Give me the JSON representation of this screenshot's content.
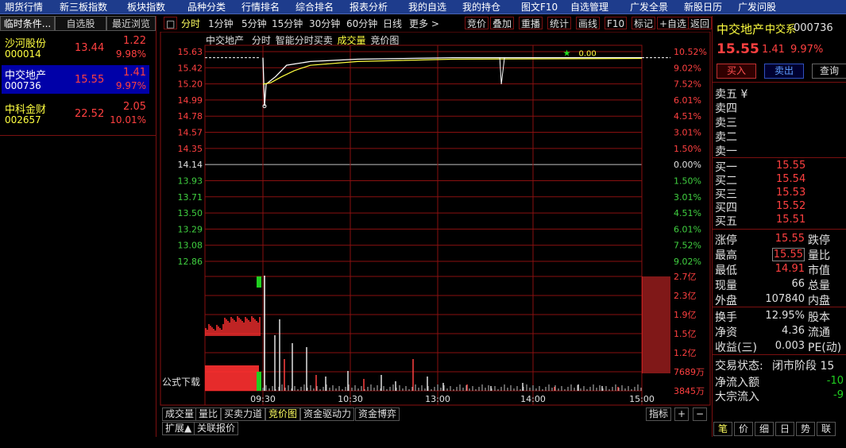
{
  "menu": [
    "期货行情",
    "新三板指数",
    "板块指数",
    "品种分类",
    "行情排名",
    "综合排名",
    "报表分析",
    "我的自选",
    "我的持仓",
    "图文F10",
    "自选管理",
    "广发全景",
    "新股日历",
    "广发问股"
  ],
  "left_tabs": [
    "临时条件...",
    "自选股",
    "最近浏览"
  ],
  "stocks": [
    {
      "name": "沙河股份",
      "code": "000014",
      "price": "13.44",
      "change": "1.22",
      "pct": "9.98%"
    },
    {
      "name": "中交地产",
      "code": "000736",
      "price": "15.55",
      "change": "1.41",
      "pct": "9.97%"
    },
    {
      "name": "中科金财",
      "code": "002657",
      "price": "22.52",
      "change": "2.05",
      "pct": "10.01%"
    }
  ],
  "toolbar": {
    "collapse": "□",
    "periods": [
      "分时",
      "1分钟",
      "5分钟",
      "15分钟",
      "30分钟",
      "60分钟",
      "日线",
      "更多 >"
    ],
    "tools": [
      "竞价",
      "叠加",
      "重播",
      "统计",
      "画线",
      "F10",
      "标记",
      "+自选",
      "返回"
    ]
  },
  "chart_info": {
    "name": "中交地产",
    "mode": "分时",
    "extra": "智能分时买卖",
    "vol": "成交量",
    "auction": "竞价图"
  },
  "formula_download": "公式下载",
  "bottom_tabs": [
    "成交量",
    "量比",
    "买卖力道",
    "竞价图",
    "资金驱动力",
    "资金博弈"
  ],
  "indicator_tab": "指标",
  "plus": "+",
  "minus": "−",
  "bottom_bar": [
    "扩展▲",
    "关联报价"
  ],
  "right": {
    "title": "中交地产",
    "subtitle": "中交系",
    "code": "000736",
    "price": "15.55",
    "change": "1.41",
    "pct": "9.97%",
    "buy": "买入",
    "sell": "卖出",
    "query": "查询",
    "ask_labels": [
      "卖五 ¥",
      "卖四",
      "卖三",
      "卖二",
      "卖一"
    ],
    "bid_labels": [
      "买一",
      "买二",
      "买三",
      "买四",
      "买五"
    ],
    "bid_prices": [
      "15.55",
      "15.54",
      "15.53",
      "15.52",
      "15.51"
    ],
    "stats": [
      {
        "l": "涨停",
        "v": "15.55",
        "r": "跌停"
      },
      {
        "l": "最高",
        "v": "15.55",
        "r": "量比"
      },
      {
        "l": "最低",
        "v": "14.91",
        "r": "市值"
      },
      {
        "l": "现量",
        "v": "66",
        "r": "总量"
      },
      {
        "l": "外盘",
        "v": "107840",
        "r": "内盘"
      }
    ],
    "stats2": [
      {
        "l": "换手",
        "v": "12.95%",
        "r": "股本"
      },
      {
        "l": "净资",
        "v": "4.36",
        "r": "流通"
      },
      {
        "l": "收益(三)",
        "v": "0.003",
        "r": "PE(动)"
      }
    ],
    "state_label": "交易状态:",
    "state_value": "闭市阶段 15",
    "flow": [
      {
        "l": "净流入额",
        "v": "-10"
      },
      {
        "l": "大宗流入",
        "v": "-9"
      }
    ],
    "tabs": [
      "笔",
      "价",
      "细",
      "日",
      "势",
      "联"
    ]
  },
  "chart_data": {
    "type": "line",
    "title": "中交地产 分时",
    "y_left_ticks": [
      "15.63",
      "15.42",
      "15.20",
      "14.99",
      "14.78",
      "14.57",
      "14.35",
      "14.14",
      "13.93",
      "13.71",
      "13.50",
      "13.29",
      "13.08",
      "12.86"
    ],
    "y_right_ticks": [
      "10.52%",
      "9.02%",
      "7.52%",
      "6.01%",
      "4.51%",
      "3.01%",
      "1.50%",
      "0.00%",
      "1.50%",
      "3.01%",
      "4.51%",
      "6.01%",
      "7.52%",
      "9.02%"
    ],
    "prev_close": 14.14,
    "ylim": [
      12.86,
      15.63
    ],
    "x_ticks": [
      "09:30",
      "10:30",
      "13:00",
      "14:00",
      "15:00"
    ],
    "price_series": [
      {
        "t": 0,
        "p": 15.55
      },
      {
        "t": 1,
        "p": 14.91
      },
      {
        "t": 2,
        "p": 15.2
      },
      {
        "t": 8,
        "p": 15.3
      },
      {
        "t": 15,
        "p": 15.45
      },
      {
        "t": 30,
        "p": 15.5
      },
      {
        "t": 60,
        "p": 15.53
      },
      {
        "t": 120,
        "p": 15.55
      },
      {
        "t": 240,
        "p": 15.55
      }
    ],
    "avg_series": [
      {
        "t": 0,
        "p": 15.2
      },
      {
        "t": 5,
        "p": 15.22
      },
      {
        "t": 12,
        "p": 15.3
      },
      {
        "t": 20,
        "p": 15.38
      },
      {
        "t": 30,
        "p": 15.45
      },
      {
        "t": 60,
        "p": 15.5
      },
      {
        "t": 120,
        "p": 15.53
      },
      {
        "t": 240,
        "p": 15.54
      }
    ],
    "marker_label": "0.00",
    "vol_ticks": [
      "2.7亿",
      "2.3亿",
      "1.9亿",
      "1.5亿",
      "1.2亿",
      "7689万",
      "3845万"
    ]
  }
}
